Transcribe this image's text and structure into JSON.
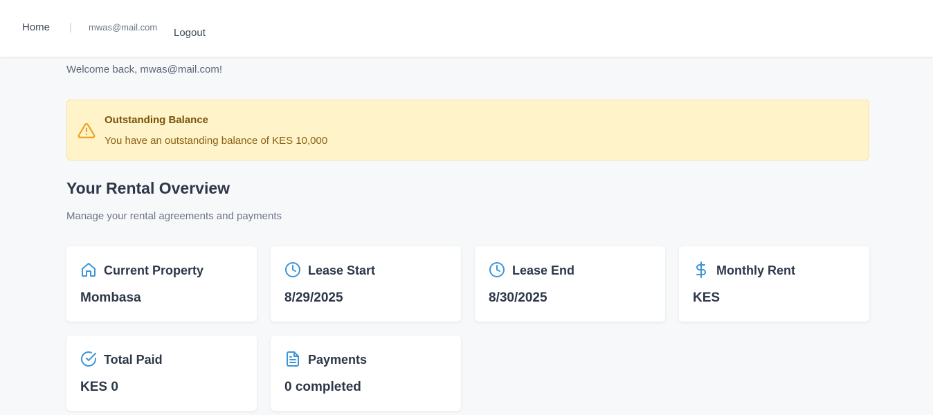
{
  "nav": {
    "home": "Home",
    "separator": "|",
    "email": "mwas@mail.com",
    "logout": "Logout"
  },
  "welcome": "Welcome back, mwas@mail.com!",
  "alert": {
    "title": "Outstanding Balance",
    "message": "You have an outstanding balance of KES 10,000",
    "icon": "warning-icon",
    "color": "#f0a020"
  },
  "overview": {
    "title": "Your Rental Overview",
    "subtitle": "Manage your rental agreements and payments"
  },
  "accent_color": "#3b95d8",
  "cards": [
    {
      "label": "Current Property",
      "value": "Mombasa",
      "icon": "home-icon"
    },
    {
      "label": "Lease Start",
      "value": "8/29/2025",
      "icon": "clock-icon"
    },
    {
      "label": "Lease End",
      "value": "8/30/2025",
      "icon": "clock-icon"
    },
    {
      "label": "Monthly Rent",
      "value": "KES",
      "icon": "dollar-icon"
    },
    {
      "label": "Total Paid",
      "value": "KES 0",
      "icon": "check-circle-icon"
    },
    {
      "label": "Payments",
      "value": "0 completed",
      "icon": "document-icon"
    }
  ]
}
